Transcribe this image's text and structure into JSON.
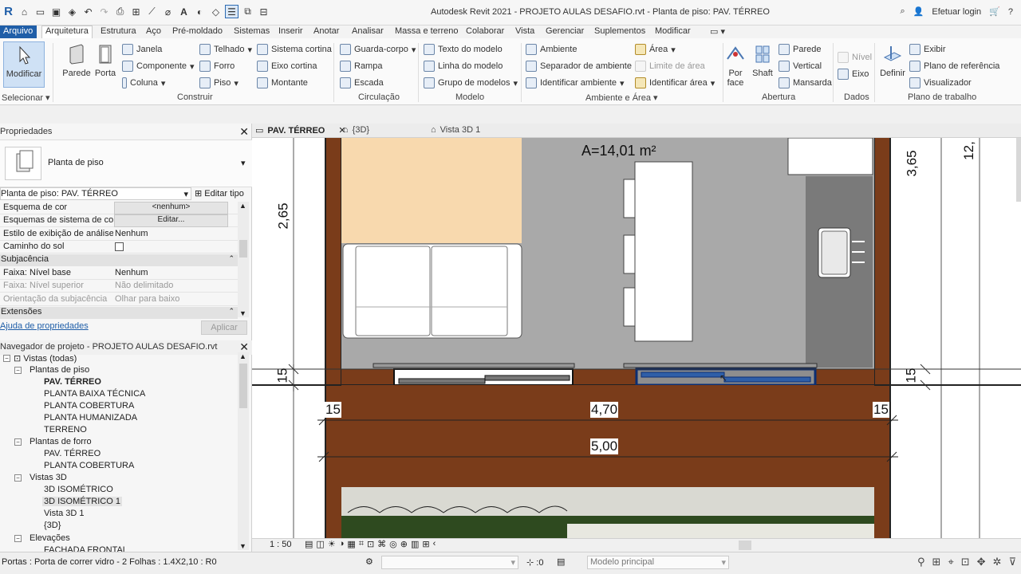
{
  "window": {
    "title": "Autodesk Revit 2021 - PROJETO AULAS DESAFIO.rvt - Planta de piso: PAV. TÉRREO",
    "login": "Efetuar login"
  },
  "menu": {
    "file": "Arquivo",
    "tabs": [
      "Arquitetura",
      "Estrutura",
      "Aço",
      "Pré-moldado",
      "Sistemas",
      "Inserir",
      "Anotar",
      "Analisar",
      "Massa e terreno",
      "Colaborar",
      "Vista",
      "Gerenciar",
      "Suplementos",
      "Modificar"
    ]
  },
  "ribbon": {
    "modify": "Modificar",
    "select": "Selecionar",
    "wall": "Parede",
    "door": "Porta",
    "window": "Janela",
    "component": "Componente",
    "column": "Coluna",
    "roof": "Telhado",
    "ceiling": "Forro",
    "floor": "Piso",
    "curtain_system": "Sistema cortina",
    "curtain_grid": "Eixo cortina",
    "mullion": "Montante",
    "build_group": "Construir",
    "railing": "Guarda-corpo",
    "ramp": "Rampa",
    "stair": "Escada",
    "circulation_group": "Circulação",
    "model_text": "Texto do modelo",
    "model_line": "Linha do modelo",
    "model_group": "Grupo de modelos",
    "model_group_label": "Modelo",
    "room": "Ambiente",
    "room_separator": "Separador de ambiente",
    "tag_room": "Identificar ambiente",
    "area": "Área",
    "area_boundary": "Limite de área",
    "tag_area": "Identificar área",
    "room_area_group": "Ambiente e Área",
    "by_face": "Por face",
    "shaft": "Shaft",
    "wall_opening": "Parede",
    "vertical": "Vertical",
    "dormer": "Mansarda",
    "opening_group": "Abertura",
    "level": "Nível",
    "grid": "Eixo",
    "datum_group": "Dados",
    "set": "Definir",
    "show": "Exibir",
    "ref_plane": "Plano de referência",
    "viewer": "Visualizador",
    "workplane_group": "Plano de trabalho"
  },
  "properties": {
    "header": "Propriedades",
    "type_name": "Planta de piso",
    "instance_selector": "Planta de piso: PAV. TÉRREO",
    "edit_type": "Editar tipo",
    "rows": [
      {
        "k": "Esquema de cor",
        "v": "<nenhum>",
        "btn": true
      },
      {
        "k": "Esquemas de sistema de cor",
        "v": "Editar...",
        "btn": true
      },
      {
        "k": "Estilo de exibição de análise...",
        "v": "Nenhum"
      },
      {
        "k": "Caminho do sol",
        "v": ""
      }
    ],
    "section_underlay": "Subjacência",
    "underlay_rows": [
      {
        "k": "Faixa: Nível base",
        "v": "Nenhum"
      },
      {
        "k": "Faixa: Nível superior",
        "v": "Não delimitado"
      },
      {
        "k": "Orientação da subjacência",
        "v": "Olhar para baixo"
      }
    ],
    "section_extents": "Extensões",
    "help_link": "Ajuda de propriedades",
    "apply": "Aplicar"
  },
  "browser": {
    "header": "Navegador de projeto - PROJETO AULAS DESAFIO.rvt",
    "root": "Vistas (todas)",
    "floor_plans": "Plantas de piso",
    "floor_plan_items": [
      "PAV. TÉRREO",
      "PLANTA BAIXA TÉCNICA",
      "PLANTA COBERTURA",
      "PLANTA HUMANIZADA",
      "TERRENO"
    ],
    "ceiling_plans": "Plantas de forro",
    "ceiling_items": [
      "PAV. TÉRREO",
      "PLANTA COBERTURA"
    ],
    "views3d": "Vistas 3D",
    "view3d_items": [
      "3D ISOMÉTRICO",
      "3D ISOMÉTRICO 1",
      "Vista 3D 1",
      "{3D}"
    ],
    "elevations": "Elevações",
    "elevation_first": "FACHADA FRONTAL"
  },
  "view_tabs": [
    "PAV. TÉRREO",
    "{3D}",
    "Vista 3D 1"
  ],
  "drawing": {
    "area_label": "A=14,01 m²",
    "dim_265": "2,65",
    "dim_15_left": "15",
    "dim_15_right": "15",
    "dim_15_bl": "15",
    "dim_15_br": "15",
    "dim_470": "4,70",
    "dim_500": "5,00",
    "dim_365": "3,65",
    "dim_12": "12,"
  },
  "view_control": {
    "scale": "1 : 50"
  },
  "status": {
    "text": "Portas : Porta de correr vidro - 2 Folhas : 1.4X2,10 : R0",
    "count": ":0",
    "model": "Modelo principal"
  },
  "colors": {
    "accent": "#1f5ea8",
    "wood": "#7a3c1a",
    "beige": "#f8d9ae",
    "floor_gray": "#a7a7a7"
  }
}
